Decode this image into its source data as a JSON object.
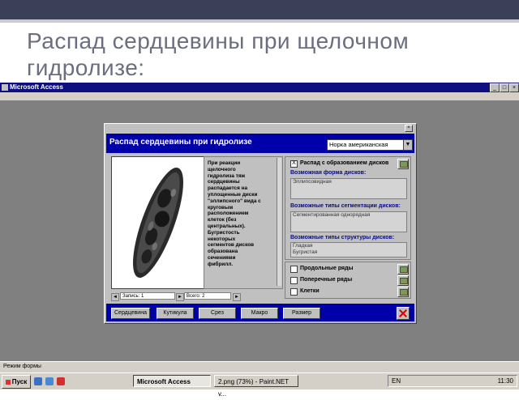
{
  "slide": {
    "title": "Распад сердцевины при щелочном гидролизе:"
  },
  "app": {
    "window_title": "Microsoft Access",
    "status_text": "Режим формы"
  },
  "form": {
    "title": "Распад сердцевины при гидролизе",
    "species_select": "Норка американская",
    "description": "При реакции щелочного гидролиза тяж сердцевины распадается на уплощенные диски \"эллипсного\" вида с круговым расположением клеток (без центральных). Бугристость некоторых сегментов дисков образована сечениями фибрилл.",
    "checkbox_disks": {
      "label": "Распад с образованием дисков",
      "checked": "X"
    },
    "disk_shapes": {
      "label": "Возможная форма дисков:",
      "values": [
        "Эллипсовидная"
      ]
    },
    "segmentation": {
      "label": "Возможные типы сегментации дисков:",
      "values": [
        "Сегментированная однорядная"
      ]
    },
    "structure": {
      "label": "Возможные типы структуры дисков:",
      "values": [
        "Гладкая",
        "Бугристая"
      ]
    },
    "rows": [
      {
        "label": "Продольные ряды"
      },
      {
        "label": "Поперечные ряды"
      },
      {
        "label": "Клетки"
      }
    ],
    "navigation": {
      "record_label": "Запись: 1",
      "total_label": "Всего: 2"
    },
    "buttons": [
      "Сердцевина",
      "Кутикула",
      "Срез",
      "Макро",
      "Размер"
    ]
  },
  "taskbar": {
    "start_label": "Пуск",
    "tasks": [
      "Microsoft Access",
      "2.png (73%) - Paint.NET v..."
    ],
    "lang": "EN",
    "clock": "11:30"
  },
  "colors": {
    "form_header": "#0000a8",
    "slide_title": "#6b6e80",
    "workspace": "#808080"
  }
}
